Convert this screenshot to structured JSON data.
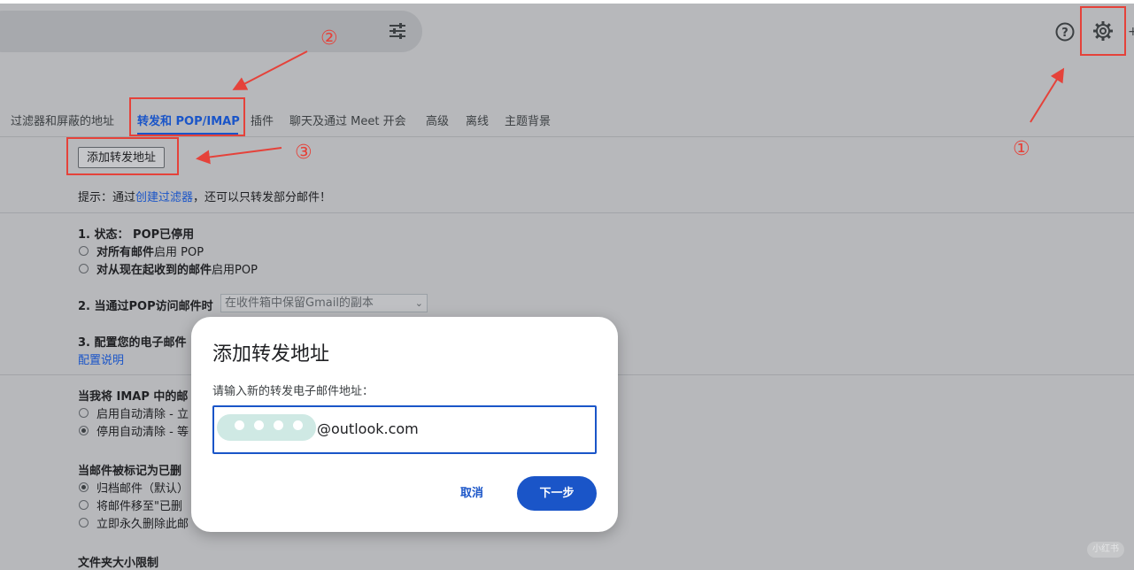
{
  "header": {
    "filter_icon": "tune-icon",
    "help_icon": "help-circle-icon",
    "settings_icon": "gear-icon",
    "edge_glyph": "+"
  },
  "tabs": [
    {
      "label": "过滤器和屏蔽的地址"
    },
    {
      "label": "转发和 POP/IMAP",
      "active": true
    },
    {
      "label": "插件"
    },
    {
      "label": "聊天及通过 Meet 开会"
    },
    {
      "label": "高级"
    },
    {
      "label": "离线"
    },
    {
      "label": "主题背景"
    }
  ],
  "forwarding": {
    "add_button": "添加转发地址",
    "tip_prefix": "提示：通过",
    "tip_link": "创建过滤器",
    "tip_suffix": "，还可以只转发部分邮件！"
  },
  "pop": {
    "status_label": "1. 状态：",
    "status_value": "POP已停用",
    "opt1_bold": "对所有邮件",
    "opt1_rest": "启用 POP",
    "opt2_bold": "对从现在起收到的邮件",
    "opt2_rest": "启用POP",
    "access_label": "2. 当通过POP访问邮件时",
    "access_select": "在收件箱中保留Gmail的副本",
    "config_label": "3. 配置您的电子邮件",
    "config_link": "配置说明"
  },
  "imap": {
    "delete_heading": "当我将 IMAP 中的邮",
    "opt_auto_on": "启用自动清除 - 立",
    "opt_auto_off": "停用自动清除 - 等",
    "deleted_heading": "当邮件被标记为已删",
    "opt_archive": "归档邮件（默认）",
    "opt_trash": "将邮件移至\"已删",
    "opt_permanent": "立即永久删除此邮",
    "folder_heading": "文件夹大小限制"
  },
  "annotations": {
    "step1": "①",
    "step2": "②",
    "step3": "③"
  },
  "dialog": {
    "title": "添加转发地址",
    "prompt": "请输入新的转发电子邮件地址：",
    "email_suffix": "@outlook.com",
    "cancel": "取消",
    "next": "下一步"
  },
  "watermark": "小红书",
  "colors": {
    "accent": "#1a55c8",
    "annotation": "#e5423a"
  }
}
